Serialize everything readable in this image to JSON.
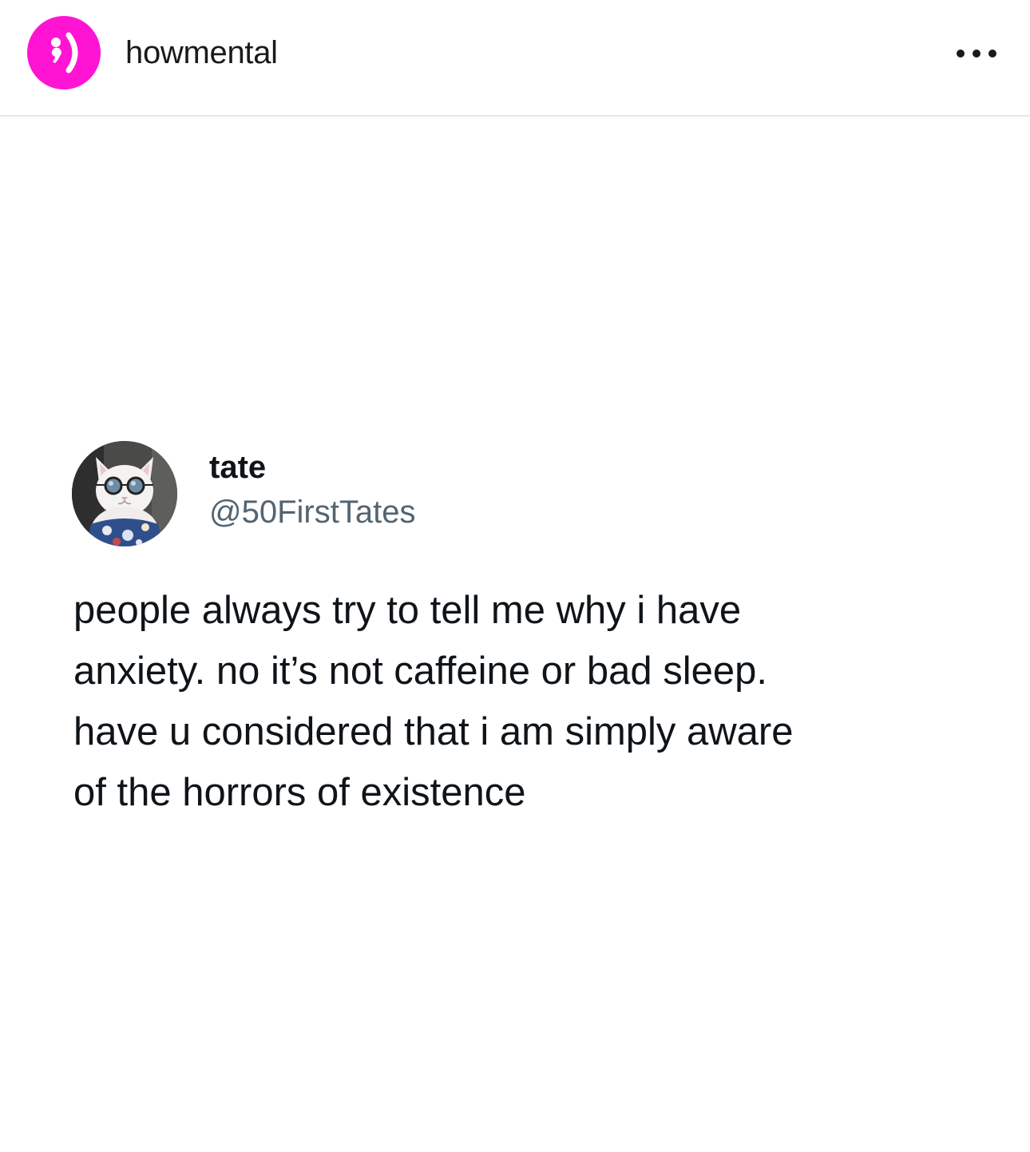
{
  "post": {
    "account_name": "howmental",
    "account_avatar_icon": "semicolon-smiley-icon",
    "avatar_color": "#ff14d4",
    "more_icon": "more-options-icon"
  },
  "tweet": {
    "display_name": "tate",
    "handle": "@50FirstTates",
    "avatar": "cat-with-sunglasses-avatar",
    "text_lines": [
      "people always try to tell me why i have",
      "anxiety. no it’s not caffeine or bad sleep.",
      "have u considered that i am simply aware",
      "of the horrors of existence"
    ]
  }
}
